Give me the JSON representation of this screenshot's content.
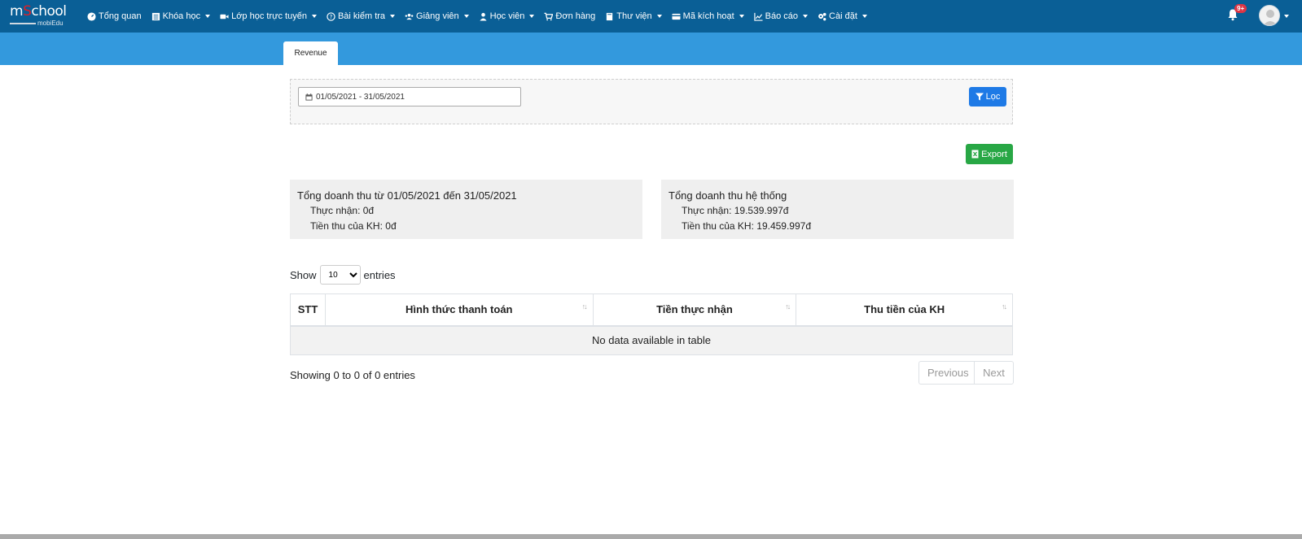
{
  "brand": {
    "name_part1": "m",
    "name_part2": "S",
    "name_part3": "chool",
    "sub": "mobiEdu"
  },
  "nav": {
    "items": [
      {
        "label": "Tổng quan",
        "icon": "dashboard-icon",
        "dropdown": false
      },
      {
        "label": "Khóa học",
        "icon": "course-icon",
        "dropdown": true
      },
      {
        "label": "Lớp học trực tuyến",
        "icon": "video-icon",
        "dropdown": true
      },
      {
        "label": "Bài kiểm tra",
        "icon": "question-icon",
        "dropdown": true
      },
      {
        "label": "Giảng viên",
        "icon": "users-icon",
        "dropdown": true
      },
      {
        "label": "Học viên",
        "icon": "user-icon",
        "dropdown": true
      },
      {
        "label": "Đơn hàng",
        "icon": "cart-icon",
        "dropdown": false
      },
      {
        "label": "Thư viện",
        "icon": "book-icon",
        "dropdown": true
      },
      {
        "label": "Mã kích hoạt",
        "icon": "card-icon",
        "dropdown": true
      },
      {
        "label": "Báo cáo",
        "icon": "chart-icon",
        "dropdown": true
      },
      {
        "label": "Cài đặt",
        "icon": "gears-icon",
        "dropdown": true
      }
    ],
    "notification_badge": "9+"
  },
  "tabs": {
    "active": "Revenue"
  },
  "filter": {
    "date_range": "01/05/2021 - 31/05/2021",
    "filter_button": "Lọc"
  },
  "export_button": "Export",
  "summary_left": {
    "title": "Tổng doanh thu từ 01/05/2021 đến 31/05/2021",
    "received": "Thực nhận: 0đ",
    "customer_paid": "Tiền thu của KH: 0đ"
  },
  "summary_right": {
    "title": "Tổng doanh thu hệ thống",
    "received": "Thực nhận: 19.539.997đ",
    "customer_paid": "Tiền thu của KH: 19.459.997đ"
  },
  "entries": {
    "show_label": "Show",
    "value": "10",
    "entries_label": "entries"
  },
  "table": {
    "headers": [
      "STT",
      "Hình thức thanh toán",
      "Tiền thực nhận",
      "Thu tiền của KH"
    ],
    "empty_message": "No data available in table"
  },
  "info": "Showing 0 to 0 of 0 entries",
  "pagination": {
    "previous": "Previous",
    "next": "Next"
  }
}
